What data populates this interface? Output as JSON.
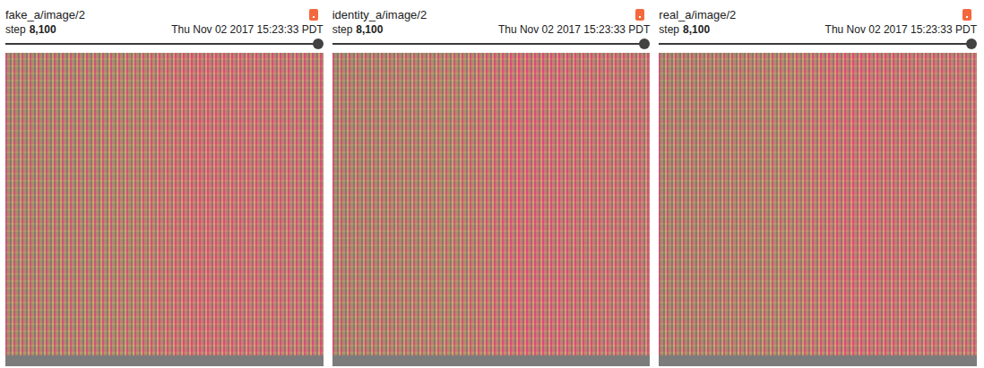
{
  "panels": [
    {
      "title": "fake_a/image/2",
      "step_label": "step",
      "step": "8,100",
      "time": "Thu Nov 02 2017 15:23:33 PDT",
      "level": 1.0
    },
    {
      "title": "identity_a/image/2",
      "step_label": "step",
      "step": "8,100",
      "time": "Thu Nov 02 2017 15:23:33 PDT",
      "level": 1.0
    },
    {
      "title": "real_a/image/2",
      "step_label": "step",
      "step": "8,100",
      "time": "Thu Nov 02 2017 15:23:33 PDT",
      "level": 1.0
    }
  ]
}
